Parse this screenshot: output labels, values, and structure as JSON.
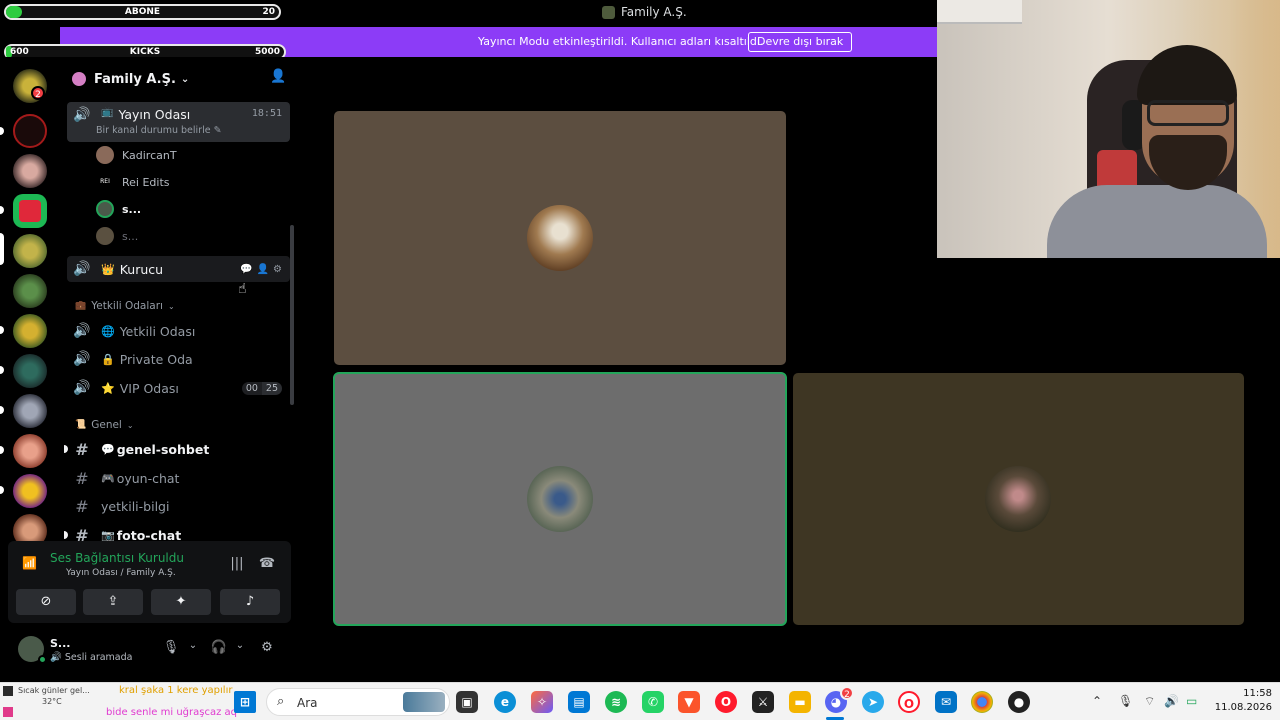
{
  "window": {
    "title": "Family A.Ş."
  },
  "overlay": {
    "abone": {
      "label": "ABONE",
      "value": "20",
      "progress": 0.05
    },
    "kicks": {
      "label": "KICKS",
      "min": "600",
      "max": "5000",
      "progress": 0.0
    }
  },
  "banner": {
    "text": "Yayıncı Modu etkinleştirildi. Kullanıcı adları kısaltıldı.",
    "button": "Devre dışı bırak"
  },
  "server_rail": {
    "badges": [
      "2"
    ]
  },
  "sidebar": {
    "server_name": "Family A.Ş.",
    "voice_active": {
      "name": "Yayın Odası",
      "time": "18:51",
      "status_hint": "Bir kanal durumu belirle",
      "members": [
        "KadircanT",
        "Rei Edits",
        "s...",
        "s..."
      ]
    },
    "kurucu": {
      "name": "Kurucu",
      "emoji": "👑"
    },
    "category_yetkili": "Yetkili Odaları",
    "yetkili_channels": [
      {
        "emoji": "🌐",
        "name": "Yetkili Odası"
      },
      {
        "emoji": "🔒",
        "name": "Private Oda"
      },
      {
        "emoji": "⭐",
        "name": "VIP Odası",
        "count_a": "00",
        "count_b": "25"
      }
    ],
    "category_genel": "Genel",
    "text_channels": [
      {
        "name": "genel-sohbet",
        "emoji": "💬",
        "bold": true
      },
      {
        "name": "oyun-chat",
        "emoji": "🎮",
        "bold": false
      },
      {
        "name": "yetkili-bilgi",
        "emoji": "",
        "bold": false
      },
      {
        "name": "foto-chat",
        "emoji": "📷",
        "bold": true
      }
    ]
  },
  "voice_panel": {
    "status": "Ses Bağlantısı Kuruldu",
    "location": "Yayın Odası / Family A.Ş."
  },
  "user_panel": {
    "name": "S...",
    "status": "Sesli aramada"
  },
  "taskbar": {
    "search_placeholder": "Ara",
    "time": "11:58",
    "date": "11.08.2026",
    "weather_label": "Sıcak günler gel...",
    "weather_temp": "32°C",
    "chat_1": "kral şaka 1 kere yapılır",
    "chat_2": "bide senle mi uğraşcaz aq",
    "discord_badge": "2"
  },
  "colors": {
    "banner": "#8c3cf7",
    "speaking": "#23a55a",
    "tile_1": "#5c4e40",
    "tile_2": "#6d6d6d",
    "tile_3": "#3e3623"
  }
}
